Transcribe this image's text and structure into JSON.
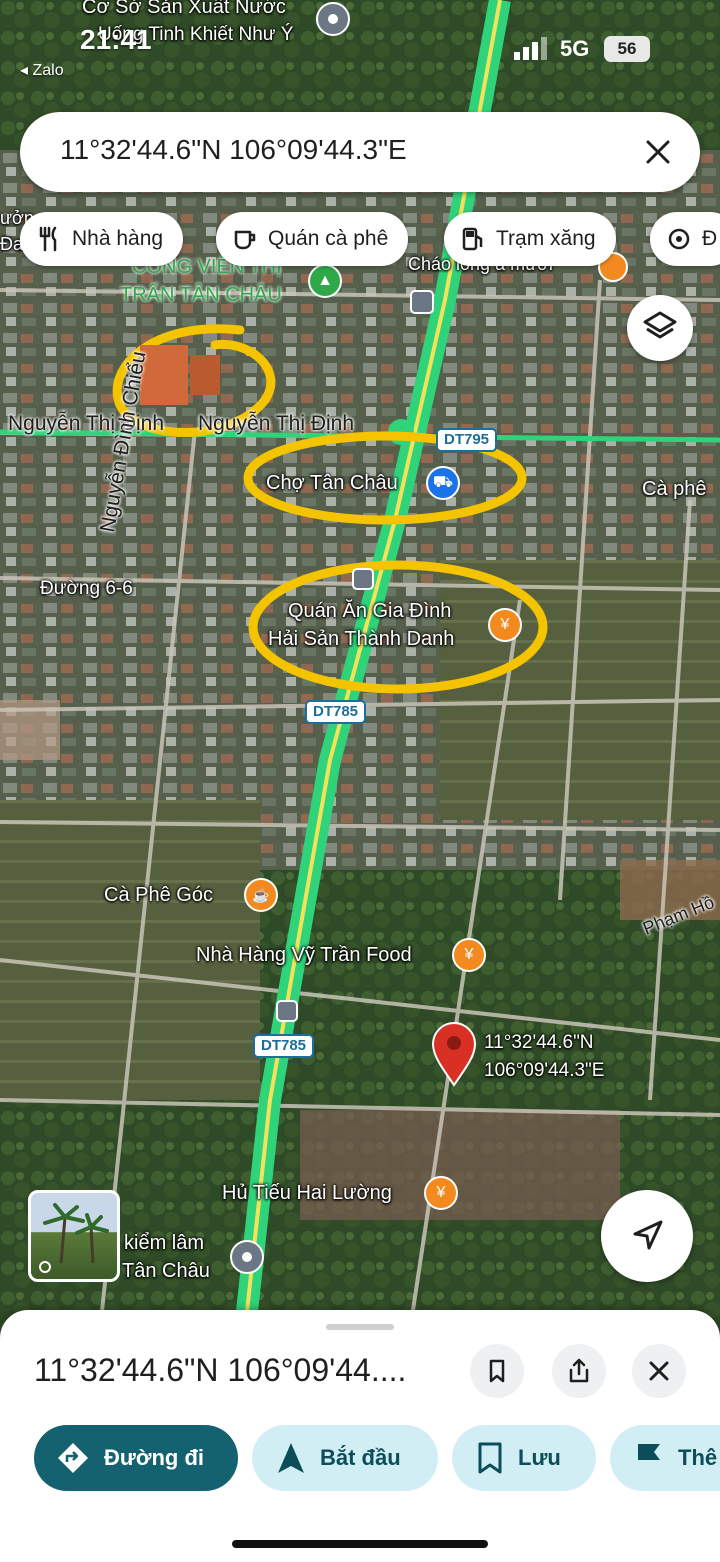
{
  "status_bar": {
    "time": "21:41",
    "back_app": "◂ Zalo",
    "network": "5G",
    "battery": "56"
  },
  "search": {
    "query": "11°32'44.6\"N 106°09'44.3\"E"
  },
  "chips": [
    {
      "label": "Nhà hàng",
      "icon": "fork-knife-icon"
    },
    {
      "label": "Quán cà phê",
      "icon": "coffee-icon"
    },
    {
      "label": "Trạm xăng",
      "icon": "fuel-icon"
    },
    {
      "label": "Đ",
      "icon": "more-icon"
    }
  ],
  "map": {
    "labels": {
      "top_place_1": "Cơ Sở Sản Xuất Nước",
      "top_place_2": "Uống Tinh Khiết Như Ý",
      "park_1": "CÔNG VIÊN THỊ",
      "park_2": "TRẤN TÂN CHÂU",
      "chao": "Cháo lòng a mười",
      "left_edge_1": "ưởn",
      "left_edge_2": "Đa",
      "road_nguyen_thi_dinh_1": "Nguyễn Thị Định",
      "road_nguyen_thi_dinh_2": "Nguyễn Thị Định",
      "road_nguyen_dinh_chieu": "Nguyễn Đình Chiểu",
      "road_duong_6_6": "Đường 6-6",
      "road_pham_ho": "Phạm Hồ",
      "cho_tan_chau": "Chợ Tân Châu",
      "ca_phe_right": "Cà phê",
      "quan_an_1": "Quán Ăn Gia Đình",
      "quan_an_2": "Hải Sản Thành Danh",
      "ca_phe_goc": "Cà Phê Góc",
      "nha_hang_vy": "Nhà Hàng Vỹ Trần Food",
      "pin_coord_1": "11°32'44.6\"N",
      "pin_coord_2": "106°09'44.3\"E",
      "hu_tieu": "Hủ Tiếu Hai Lường",
      "kiem_lam_1": "kiểm lâm",
      "kiem_lam_2": "Tân Châu"
    },
    "route_shields": [
      "DT795",
      "DT785",
      "DT785"
    ],
    "highlight_color": "#f5c400",
    "road_color": "#2fd47a",
    "pin_color": "#d93025"
  },
  "sheet": {
    "title": "11°32'44.6\"N 106°09'44....",
    "actions": [
      {
        "label": "Đường đi",
        "icon": "directions-icon"
      },
      {
        "label": "Bắt đầu",
        "icon": "navigation-arrow-icon"
      },
      {
        "label": "Lưu",
        "icon": "bookmark-icon"
      },
      {
        "label": "Thê",
        "icon": "flag-icon"
      }
    ]
  }
}
